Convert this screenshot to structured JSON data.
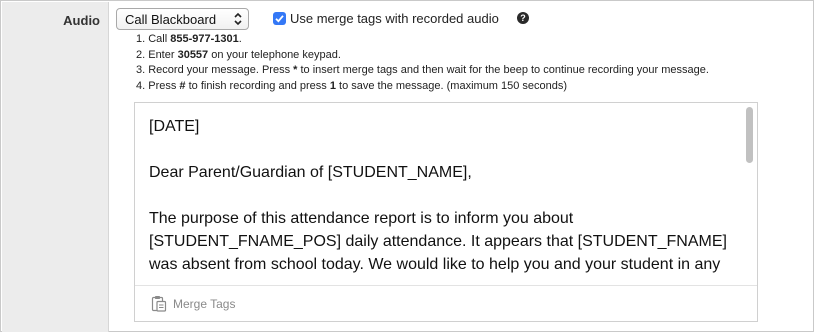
{
  "field": {
    "label": "Audio"
  },
  "select": {
    "value": "Call Blackboard"
  },
  "checkbox": {
    "checked": true,
    "label": "Use merge tags with recorded audio"
  },
  "help": {
    "glyph": "?"
  },
  "steps": [
    {
      "before": "1. Call ",
      "bold": "855-977-1301",
      "after": "."
    },
    {
      "before": "2. Enter ",
      "bold": "30557",
      "after": " on your telephone keypad."
    },
    {
      "before": "3. Record your message. Press ",
      "bold": "*",
      "after": " to insert merge tags and then wait for the beep to continue recording your message."
    },
    {
      "before": "4. Press ",
      "bold": "#",
      "after": " to finish recording and press ",
      "bold2": "1",
      "after2": " to save the message. (maximum 150 seconds)"
    }
  ],
  "editor": {
    "paragraphs": [
      "[DATE]",
      "Dear Parent/Guardian of [STUDENT_NAME],",
      "The purpose of this attendance report is to inform you about [STUDENT_FNAME_POS] daily attendance.  It appears that [STUDENT_FNAME] was absent from school today.  We would like to help you and your student in any way we can to alleviate this attendance concern.  Any time a student is"
    ]
  },
  "footer": {
    "merge_label": "Merge Tags",
    "merge_icon": "clipboard-icon"
  }
}
